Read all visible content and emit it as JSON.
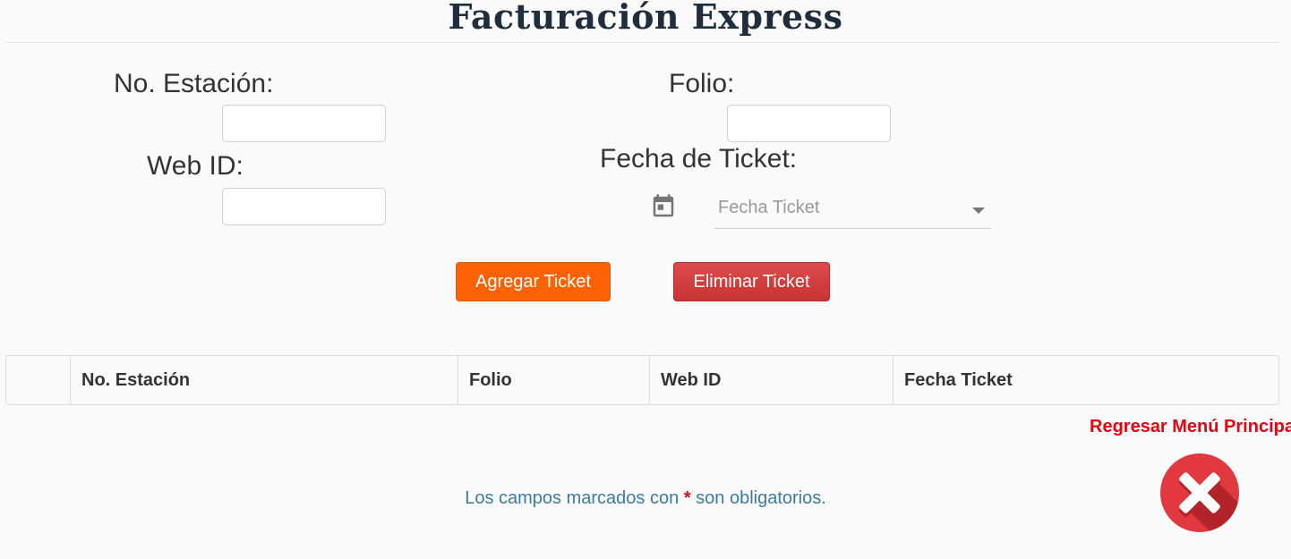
{
  "page": {
    "title": "Facturación Express"
  },
  "form": {
    "station_label": "No. Estación:",
    "station_value": "",
    "folio_label": "Folio:",
    "folio_value": "",
    "webid_label": "Web ID:",
    "webid_value": "",
    "date_label": "Fecha de Ticket:",
    "date_placeholder": "Fecha Ticket",
    "calendar_icon": "calendar-icon"
  },
  "buttons": {
    "add_label": "Agregar Ticket",
    "delete_label": "Eliminar Ticket",
    "add_color": "#ff6205",
    "delete_color": "#d03a3a"
  },
  "table": {
    "columns": [
      "",
      "No. Estación",
      "Folio",
      "Web ID",
      "Fecha Ticket"
    ],
    "rows": []
  },
  "nav": {
    "back_label": "Regresar Menú Principal",
    "close_icon": "close-x-icon",
    "back_color": "#e30613"
  },
  "footer": {
    "note_before": "Los campos marcados con",
    "note_star": "*",
    "note_after": "son obligatorios."
  }
}
